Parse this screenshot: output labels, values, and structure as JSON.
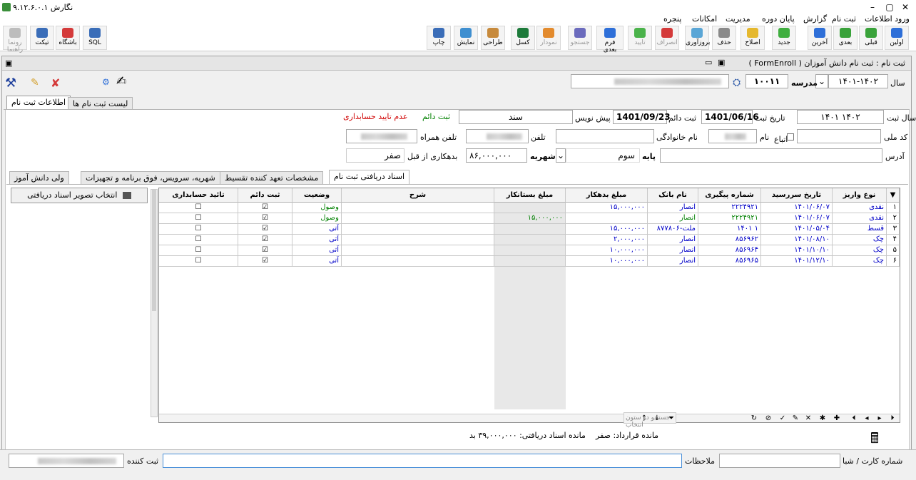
{
  "window": {
    "title": "نگارش ۹.۱۲.۶.۰.۱"
  },
  "menu": [
    "ورود اطلاعات",
    "ثبت نام",
    "گزارش",
    "پایان دوره",
    "مدیریت",
    "امکانات",
    "پنجره"
  ],
  "toolbar": {
    "first": "اولین",
    "prev": "قبلی",
    "next": "بعدی",
    "last": "آخرین",
    "new": "جدید",
    "edit": "اصلاح",
    "delete": "حذف",
    "refresh": "بروزآوری",
    "cancel": "انصراف",
    "confirm": "تایید",
    "next_form": "فرم بعدی",
    "save_disabled": "جستجو",
    "report": "نمودار",
    "excel": "کسل",
    "design": "طراحی",
    "preview": "نمایش",
    "print": "چاپ",
    "sql": "SQL",
    "shop": "باشگاه",
    "ticket": "تیکت",
    "help": "رونما راهنما"
  },
  "form": {
    "title": "ثبت نام : ثبت نام دانش آموزان ( FormEnroll )",
    "year_label": "سال",
    "year_value": "۱۴۰۱-۱۴۰۲",
    "school_label": "مدرسه",
    "school_code": "۱۰۰۱۱",
    "tab_info": "اطلاعات ثبت نام",
    "tab_list": "لیست ثبت نام ها",
    "enroll_year_label": "سال ثبت",
    "enroll_year_value": "۱۴۰۱ ۱۴۰۲",
    "enroll_date_label": "تاریخ ثبت",
    "enroll_date_value": "1401/06/16",
    "permanent_label": "ثبت دائم",
    "permanent_value": "1401/09/23",
    "draft_label": "پیش نویس",
    "doc_label": "سند",
    "status_green": "ثبت دائم",
    "status_red": "عدم تایید حسابداری",
    "national_code_label": "کد ملی",
    "nationality_label": "اتباع",
    "name_label": "نام",
    "family_label": "نام خانوادگی",
    "phone_label": "تلفن",
    "mobile_label": "تلفن همراه",
    "address_label": "آدرس",
    "grade_label": "پایه",
    "grade_value": "سوم",
    "tuition_label": "شهریه",
    "tuition_value": "۸۶,۰۰۰,۰۰۰",
    "debt_label": "بدهکاری از قبل",
    "debt_value": "صفر",
    "subtabs": [
      "اسناد دریافتی ثبت نام",
      "مشخصات تعهد کننده تقسیط",
      "شهریه، سرویس، فوق برنامه و تجهیزات",
      "ولی دانش آموز"
    ],
    "select_image_button": "انتخاب تصویر اسناد دریافتی",
    "grid_headers": [
      "نوع واریز",
      "تاریخ سررسید",
      "شماره پیگیری",
      "نام بانک",
      "مبلغ بدهکار",
      "مبلغ بستانکار",
      "شرح",
      "وضعیت",
      "ثبت دائم",
      "تائید حسابداری"
    ],
    "grid_rows": [
      {
        "num": "۱",
        "type": "نقدی",
        "due": "۱۴۰۱/۰۶/۰۷",
        "track": "۲۲۲۴۹۲۱",
        "bank": "انصار",
        "debit": "۱۵,۰۰۰,۰۰۰",
        "credit": "",
        "desc": "",
        "status": "وصول",
        "perm": "☑",
        "acct": "☐"
      },
      {
        "num": "۲",
        "type": "نقدی",
        "due": "۱۴۰۱/۰۶/۰۷",
        "track": "۲۲۲۴۹۲۱",
        "bank": "انصار",
        "debit": "",
        "credit": "۱۵,۰۰۰,۰۰۰",
        "desc": "",
        "status": "وصول",
        "perm": "☑",
        "acct": "☐"
      },
      {
        "num": "۳",
        "type": "قسط",
        "due": "۱۴۰۱/۰۵/۰۴",
        "track": "۱۴۰۱ ۱",
        "bank": "۸۷۷۸۰۶-ملت",
        "debit": "۱۵,۰۰۰,۰۰۰",
        "credit": "",
        "desc": "",
        "status": "آتی",
        "perm": "☑",
        "acct": "☐"
      },
      {
        "num": "۴",
        "type": "چک",
        "due": "۱۴۰۱/۰۸/۱۰",
        "track": "۸۵۶۹۶۲",
        "bank": "انصار",
        "debit": "۲,۰۰۰,۰۰۰",
        "credit": "",
        "desc": "",
        "status": "آتی",
        "perm": "☑",
        "acct": "☐"
      },
      {
        "num": "۵",
        "type": "چک",
        "due": "۱۴۰۱/۱۰/۱۰",
        "track": "۸۵۶۹۶۴",
        "bank": "انصار",
        "debit": "۱۰,۰۰۰,۰۰۰",
        "credit": "",
        "desc": "",
        "status": "آتی",
        "perm": "☑",
        "acct": "☐"
      },
      {
        "num": "۶",
        "type": "چک",
        "due": "۱۴۰۱/۱۲/۱۰",
        "track": "۸۵۶۹۶۵",
        "bank": "انصار",
        "debit": "۱۰,۰۰۰,۰۰۰",
        "credit": "",
        "desc": "",
        "status": "آتی",
        "perm": "☑",
        "acct": "☐"
      }
    ],
    "search_placeholder": "جستجو در ستون انتخاب",
    "contract_balance": "مانده قرارداد: صفر",
    "received_balance": "مانده اسناد دریافتی: ۳۹,۰۰۰,۰۰۰ بد",
    "card_label": "شماره کارت / شبا",
    "notes_label": "ملاحظات",
    "registrar_label": "ثبت کننده"
  },
  "colors": {
    "accent_blue": "#0000c8",
    "status_green": "#008000",
    "status_red": "#d00000"
  }
}
